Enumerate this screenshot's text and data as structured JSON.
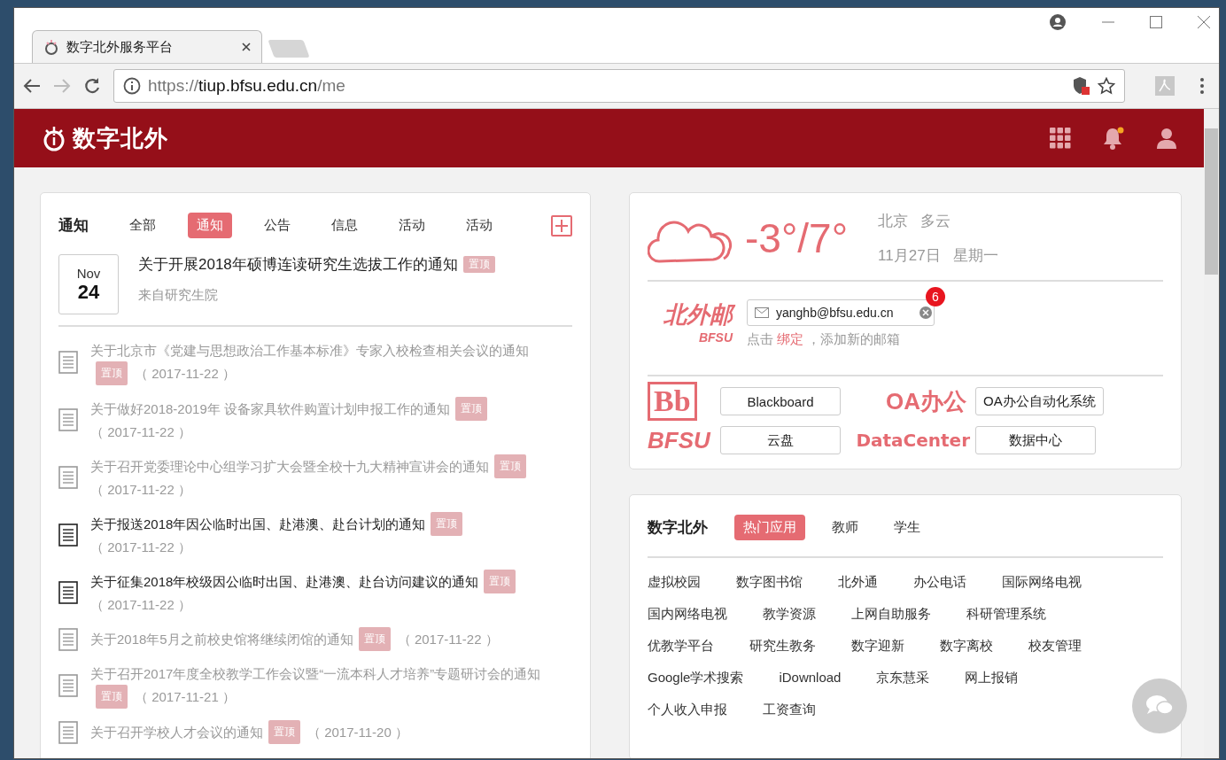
{
  "browser": {
    "tab_title": "数字北外服务平台",
    "url_scheme": "https://",
    "url_host": "tiup.bfsu.edu.cn",
    "url_path": "/me"
  },
  "header": {
    "logo": "数字北外"
  },
  "notices": {
    "title": "通知",
    "tabs": [
      {
        "label": "全部",
        "selected": false
      },
      {
        "label": "通知",
        "selected": true
      },
      {
        "label": "公告",
        "selected": false
      },
      {
        "label": "信息",
        "selected": false
      },
      {
        "label": "活动",
        "selected": false
      },
      {
        "label": "活动",
        "selected": false
      }
    ],
    "featured": {
      "month": "Nov",
      "day": "24",
      "title": "关于开展2018年硕博连读研究生选拔工作的通知",
      "tag": "置顶",
      "source": "来自研究生院"
    },
    "items": [
      {
        "title": "关于北京市《党建与思想政治工作基本标准》专家入校检查相关会议的通知",
        "tag": "置顶",
        "date": "（ 2017-11-22 ）",
        "read": true
      },
      {
        "title": "关于做好2018-2019年 设备家具软件购置计划申报工作的通知",
        "tag": "置顶",
        "date": "（ 2017-11-22 ）",
        "read": true
      },
      {
        "title": "关于召开党委理论中心组学习扩大会暨全校十九大精神宣讲会的通知",
        "tag": "置顶",
        "date": "（ 2017-11-22 ）",
        "read": true
      },
      {
        "title": "关于报送2018年因公临时出国、赴港澳、赴台计划的通知",
        "tag": "置顶",
        "date": "（ 2017-11-22 ）",
        "read": false
      },
      {
        "title": "关于征集2018年校级因公临时出国、赴港澳、赴台访问建议的通知",
        "tag": "置顶",
        "date": "（ 2017-11-22 ）",
        "read": false
      },
      {
        "title": "关于2018年5月之前校史馆将继续闭馆的通知",
        "tag": "置顶",
        "date": "（ 2017-11-22 ）",
        "read": true
      },
      {
        "title": "关于召开2017年度全校教学工作会议暨“一流本科人才培养”专题研讨会的通知",
        "tag": "置顶",
        "date": "（ 2017-11-21 ）",
        "read": true
      },
      {
        "title": "关于召开学校人才会议的通知",
        "tag": "置顶",
        "date": "（ 2017-11-20 ）",
        "read": true
      }
    ]
  },
  "weather": {
    "temperature": "-3°/7°",
    "city": "北京",
    "condition": "多云",
    "date": "11月27日",
    "weekday": "星期一"
  },
  "mail": {
    "logo": "北外邮",
    "logo_sub": "BFSU",
    "address": "yanghb@bfsu.edu.cn",
    "count": "6",
    "hint_before": "点击",
    "hint_link": "绑定",
    "hint_after": "，添加新的邮箱"
  },
  "systems": [
    {
      "logo": "Bb",
      "kind": "bb",
      "label": "Blackboard"
    },
    {
      "logo": "OA办公",
      "kind": "oa",
      "label": "OA办公自动化系统"
    },
    {
      "logo": "BFSU",
      "kind": "cloud",
      "label": "云盘"
    },
    {
      "logo": "DataCenter",
      "kind": "dc",
      "label": "数据中心"
    }
  ],
  "apps": {
    "title": "数字北外",
    "tabs": [
      {
        "label": "热门应用",
        "selected": true
      },
      {
        "label": "教师",
        "selected": false
      },
      {
        "label": "学生",
        "selected": false
      }
    ],
    "rows": [
      [
        "虚拟校园",
        "数字图书馆",
        "北外通",
        "办公电话",
        "国际网络电视"
      ],
      [
        "国内网络电视",
        "教学资源",
        "上网自助服务",
        "科研管理系统"
      ],
      [
        "优教学平台",
        "研究生教务",
        "数字迎新",
        "数字离校",
        "校友管理"
      ],
      [
        "Google学术搜索",
        "iDownload",
        "京东慧采",
        "网上报销"
      ],
      [
        "个人收入申报",
        "工资查询"
      ]
    ]
  }
}
